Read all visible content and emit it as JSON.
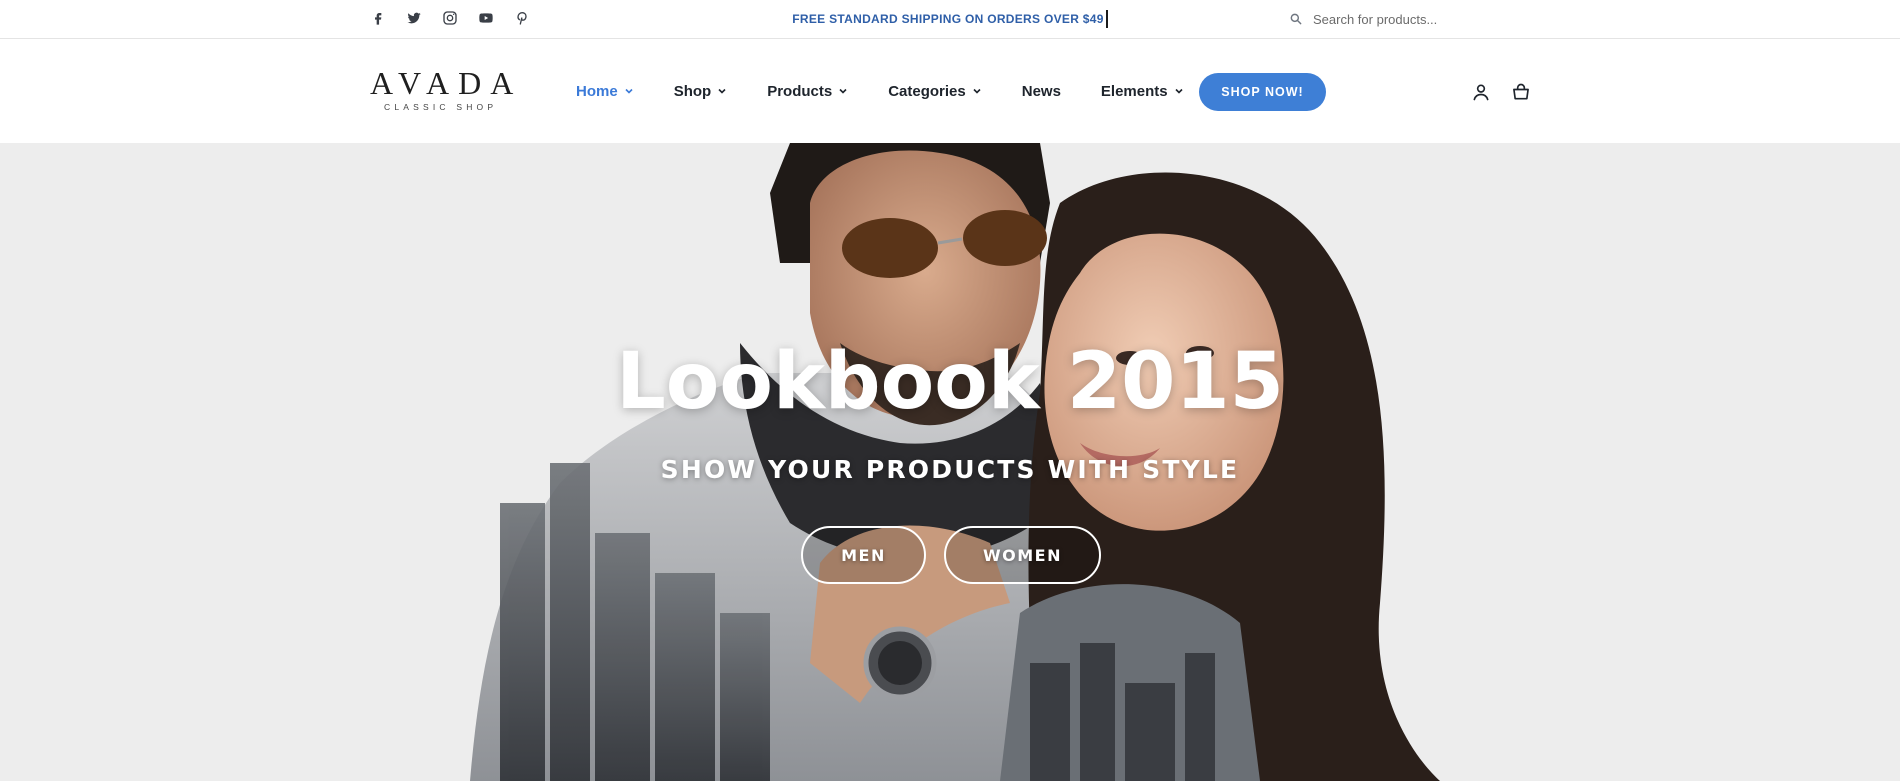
{
  "topbar": {
    "social": [
      {
        "name": "facebook-icon",
        "glyph": "facebook"
      },
      {
        "name": "twitter-icon",
        "glyph": "twitter"
      },
      {
        "name": "instagram-icon",
        "glyph": "instagram"
      },
      {
        "name": "youtube-icon",
        "glyph": "youtube"
      },
      {
        "name": "pinterest-icon",
        "glyph": "pinterest"
      }
    ],
    "promo_text": "FREE STANDARD SHIPPING ON ORDERS OVER $49",
    "search_placeholder": "Search for products...",
    "search_icon": "search-icon"
  },
  "header": {
    "logo": {
      "word": "AVADA",
      "tagline": "CLASSIC SHOP"
    },
    "nav": [
      {
        "label": "Home",
        "has_dropdown": true,
        "active": true
      },
      {
        "label": "Shop",
        "has_dropdown": true,
        "active": false
      },
      {
        "label": "Products",
        "has_dropdown": true,
        "active": false
      },
      {
        "label": "Categories",
        "has_dropdown": true,
        "active": false
      },
      {
        "label": "News",
        "has_dropdown": false,
        "active": false
      },
      {
        "label": "Elements",
        "has_dropdown": true,
        "active": false
      }
    ],
    "cta_label": "SHOP NOW!",
    "icons": [
      "user-icon",
      "shopping-bag-icon"
    ]
  },
  "hero": {
    "title": "Lookbook 2015",
    "subtitle": "SHOW YOUR PRODUCTS WITH STYLE",
    "buttons": [
      {
        "label": "MEN"
      },
      {
        "label": "WOMEN"
      }
    ]
  },
  "colors": {
    "accent": "#3e7fd6",
    "nav_active": "#3b7ad8",
    "promo": "#2f5fa8",
    "hero_bg": "#ededed",
    "text_dark": "#1e242c"
  }
}
